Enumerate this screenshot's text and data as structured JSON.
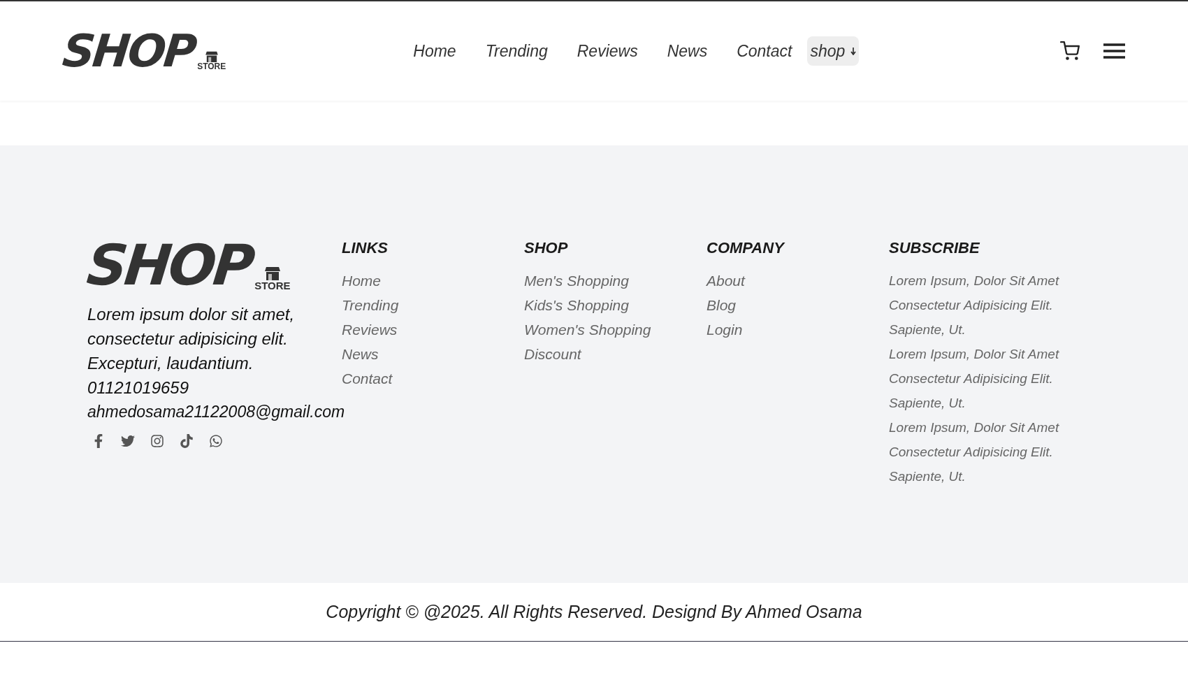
{
  "header": {
    "logo": {
      "word": "SHOP",
      "tag": "STORE"
    },
    "nav": [
      {
        "label": "Home"
      },
      {
        "label": "Trending"
      },
      {
        "label": "Reviews"
      },
      {
        "label": "News"
      },
      {
        "label": "Contact"
      }
    ],
    "dropdown": {
      "label": "shop"
    }
  },
  "footer": {
    "logo": {
      "word": "SHOP",
      "tag": "STORE"
    },
    "description": "Lorem ipsum dolor sit amet, consectetur adipisicing elit. Excepturi, laudantium.",
    "phone": "01121019659",
    "email": "ahmedosama21122008@gmail.com",
    "columns": [
      {
        "title": "LINKS",
        "items": [
          "Home",
          "Trending",
          "Reviews",
          "News",
          "Contact"
        ]
      },
      {
        "title": "SHOP",
        "items": [
          "Men's Shopping",
          "Kids's Shopping",
          "Women's Shopping",
          "Discount"
        ]
      },
      {
        "title": "COMPANY",
        "items": [
          "About",
          "Blog",
          "Login"
        ]
      }
    ],
    "subscribe": {
      "title": "SUBSCRIBE",
      "paragraphs": [
        "Lorem Ipsum, Dolor Sit Amet Consectetur Adipisicing Elit. Sapiente, Ut.",
        "Lorem Ipsum, Dolor Sit Amet Consectetur Adipisicing Elit. Sapiente, Ut.",
        "Lorem Ipsum, Dolor Sit Amet Consectetur Adipisicing Elit. Sapiente, Ut."
      ]
    }
  },
  "copyright": "Copyright © @2025. All Rights Reserved. Designd By Ahmed Osama"
}
